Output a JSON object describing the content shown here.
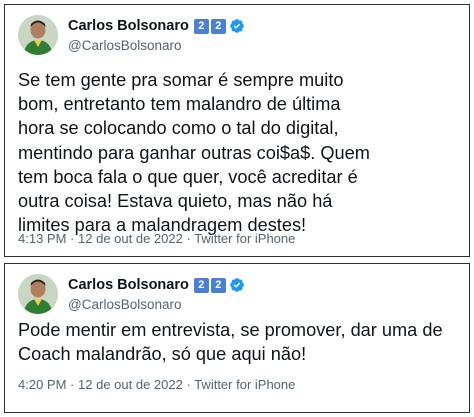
{
  "tweets": [
    {
      "author": {
        "display_name": "Carlos Bolsonaro",
        "badges": [
          "2",
          "2"
        ],
        "verified": true,
        "handle": "@CarlosBolsonaro"
      },
      "text": "Se tem gente pra somar é sempre muito\nbom, entretanto tem malandro de última\nhora se colocando como o tal do digital,\nmentindo para ganhar outras coi$a$. Quem\ntem boca fala o que quer, você acreditar é\noutra coisa! Estava quieto, mas não há\nlimites para a malandragem destes!",
      "time": "4:13 PM",
      "date": "12 de out de 2022",
      "source": "Twitter for iPhone"
    },
    {
      "author": {
        "display_name": "Carlos Bolsonaro",
        "badges": [
          "2",
          "2"
        ],
        "verified": true,
        "handle": "@CarlosBolsonaro"
      },
      "text": "Pode mentir em entrevista, se promover, dar uma de\nCoach malandrão, só que aqui não!",
      "time": "4:20 PM",
      "date": "12 de out de 2022",
      "source": "Twitter for iPhone"
    }
  ],
  "separator": "·",
  "colors": {
    "text": "#0f1419",
    "secondary": "#536471",
    "verified": "#1d9bf0",
    "badge": "#4a7fd6"
  }
}
